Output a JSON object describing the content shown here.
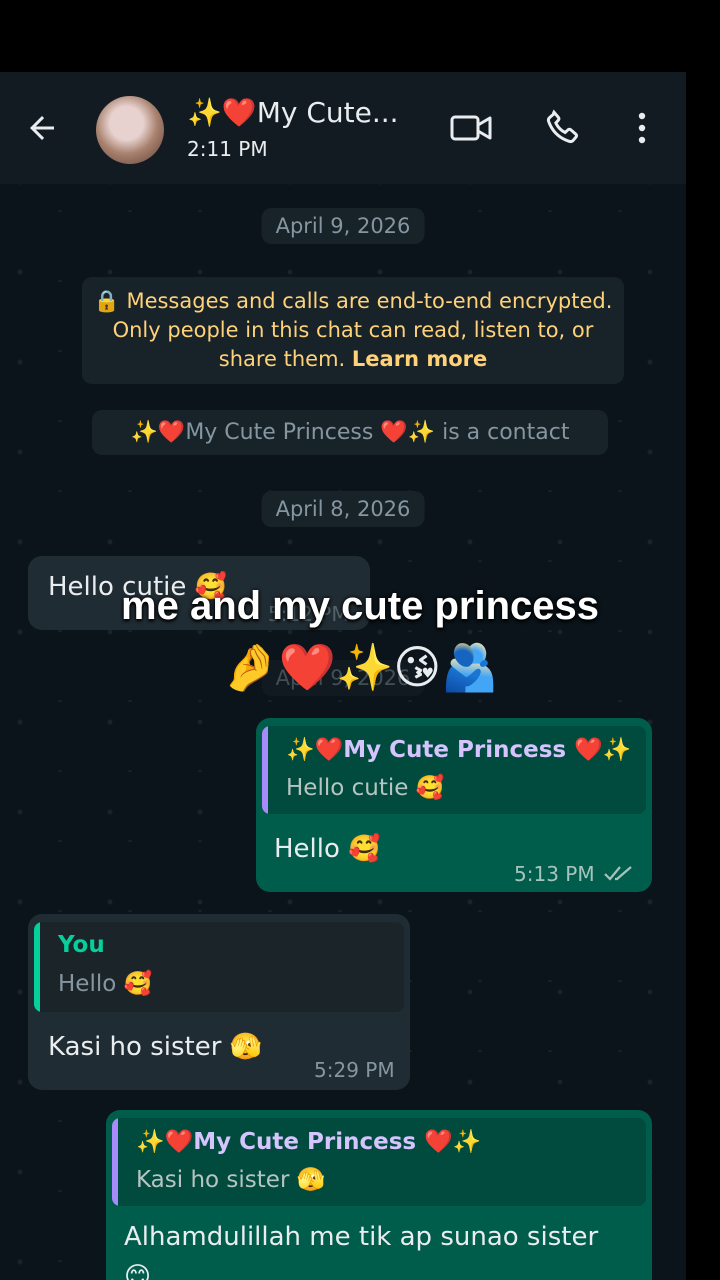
{
  "header": {
    "title": "✨❤️My Cute...",
    "subtitle": "2:11 PM"
  },
  "chat": {
    "date1": "April 9, 2026",
    "encryption_prefix": "🔒 Messages and calls are end-to-end encrypted. Only people in this chat can read, listen to, or share them. ",
    "learn_more": "Learn more",
    "contact_notice": "✨❤️My Cute Princess ❤️✨ is a contact",
    "date2": "April 8, 2026",
    "msg1": {
      "text": "Hello cutie 🥰",
      "time": "5:12 PM"
    },
    "date3": "April 9, 2026",
    "msg2": {
      "quote_name": "✨❤️My Cute Princess ❤️✨",
      "quote_text": "Hello cutie 🥰",
      "text": "Hello 🥰",
      "time": "5:13 PM"
    },
    "msg3": {
      "quote_name": "You",
      "quote_text": "Hello 🥰",
      "text": "Kasi ho sister 🫣",
      "time": "5:29 PM"
    },
    "msg4": {
      "quote_name": "✨❤️My Cute Princess ❤️✨",
      "quote_text": "Kasi ho sister 🫣",
      "text": "Alhamdulillah me tik ap sunao sister",
      "emoji_peek": "😊"
    }
  },
  "overlay": {
    "caption": "me and my cute princess",
    "emojis": "🤌❤️✨😘🫂"
  },
  "colors": {
    "accent_green": "#005c4b",
    "incoming": "#202c33",
    "quote_bar_purple": "#a78bfa",
    "quote_bar_green": "#06cf9c",
    "read_ticks": "#a7c4bc"
  }
}
